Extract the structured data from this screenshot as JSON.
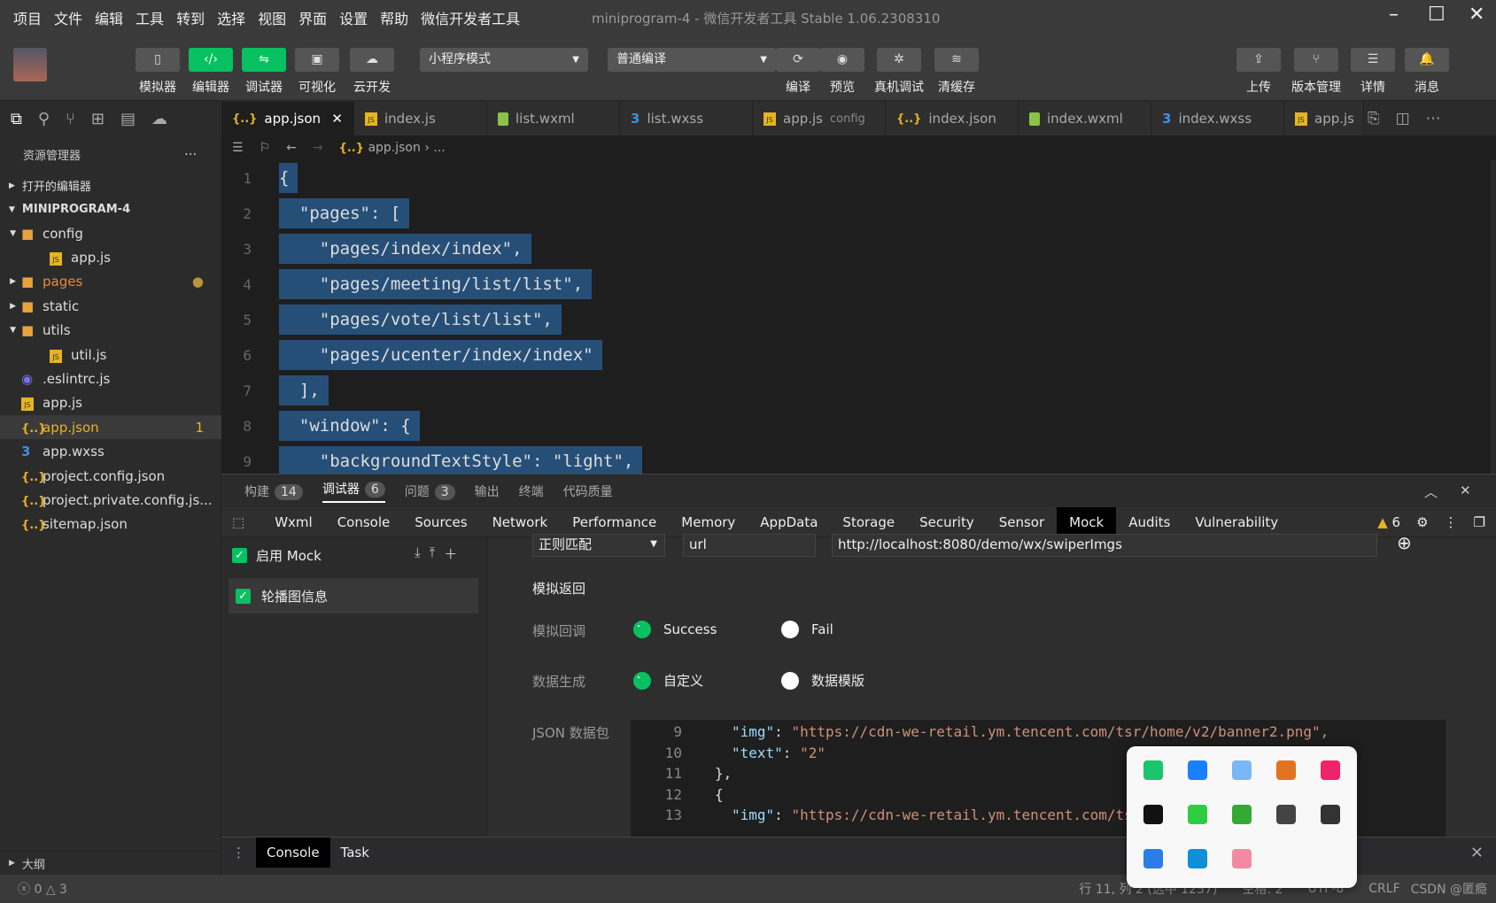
{
  "menu": [
    "项目",
    "文件",
    "编辑",
    "工具",
    "转到",
    "选择",
    "视图",
    "界面",
    "设置",
    "帮助",
    "微信开发者工具"
  ],
  "window_title": "miniprogram-4 - 微信开发者工具 Stable 1.06.2308310",
  "toolbar": {
    "left": [
      {
        "label": "模拟器",
        "icon": "phone-icon",
        "active": false
      },
      {
        "label": "编辑器",
        "icon": "code-icon",
        "active": true
      },
      {
        "label": "调试器",
        "icon": "debug-icon",
        "active": true
      },
      {
        "label": "可视化",
        "icon": "layout-icon",
        "active": false
      },
      {
        "label": "云开发",
        "icon": "cloud-icon",
        "active": false
      }
    ],
    "mode_select": "小程序模式",
    "compile_select": "普通编译",
    "mid": [
      {
        "label": "编译",
        "icon": "refresh-icon"
      },
      {
        "label": "预览",
        "icon": "eye-icon"
      },
      {
        "label": "真机调试",
        "icon": "bug-icon"
      },
      {
        "label": "清缓存",
        "icon": "layers-icon"
      }
    ],
    "right": [
      {
        "label": "上传",
        "icon": "upload-icon"
      },
      {
        "label": "版本管理",
        "icon": "branch-icon"
      },
      {
        "label": "详情",
        "icon": "menu-icon"
      },
      {
        "label": "消息",
        "icon": "bell-icon"
      }
    ]
  },
  "editor_tabs": [
    {
      "label": "app.json",
      "type": "json",
      "active": true
    },
    {
      "label": "index.js",
      "type": "js"
    },
    {
      "label": "list.wxml",
      "type": "wxml"
    },
    {
      "label": "list.wxss",
      "type": "wxss"
    },
    {
      "label": "app.js",
      "suffix": "config",
      "type": "js"
    },
    {
      "label": "index.json",
      "type": "json"
    },
    {
      "label": "index.wxml",
      "type": "wxml"
    },
    {
      "label": "index.wxss",
      "type": "wxss"
    },
    {
      "label": "app.js",
      "type": "js"
    }
  ],
  "sidebar": {
    "title": "资源管理器",
    "more": "...",
    "sections": [
      "打开的编辑器",
      "MINIPROGRAM-4"
    ],
    "items": [
      {
        "label": "config",
        "type": "folder",
        "depth": 1,
        "open": true
      },
      {
        "label": "app.js",
        "type": "js",
        "depth": 2
      },
      {
        "label": "pages",
        "type": "folder",
        "depth": 1,
        "open": false,
        "modified": true
      },
      {
        "label": "static",
        "type": "folder",
        "depth": 1,
        "open": false
      },
      {
        "label": "utils",
        "type": "folder",
        "depth": 1,
        "open": true
      },
      {
        "label": "util.js",
        "type": "js",
        "depth": 2
      },
      {
        "label": ".eslintrc.js",
        "type": "eslint",
        "depth": 1
      },
      {
        "label": "app.js",
        "type": "js",
        "depth": 1
      },
      {
        "label": "app.json",
        "type": "json",
        "depth": 1,
        "selected": true,
        "badge": "1"
      },
      {
        "label": "app.wxss",
        "type": "wxss",
        "depth": 1
      },
      {
        "label": "project.config.json",
        "type": "json",
        "depth": 1
      },
      {
        "label": "project.private.config.js...",
        "type": "json",
        "depth": 1
      },
      {
        "label": "sitemap.json",
        "type": "json",
        "depth": 1
      }
    ],
    "outline": "大纲"
  },
  "breadcrumb": [
    "app.json",
    "..."
  ],
  "code_lines": [
    {
      "n": "1",
      "t": "{"
    },
    {
      "n": "2",
      "t": "  \"pages\": ["
    },
    {
      "n": "3",
      "t": "    \"pages/index/index\","
    },
    {
      "n": "4",
      "t": "    \"pages/meeting/list/list\","
    },
    {
      "n": "5",
      "t": "    \"pages/vote/list/list\","
    },
    {
      "n": "6",
      "t": "    \"pages/ucenter/index/index\""
    },
    {
      "n": "7",
      "t": "  ],"
    },
    {
      "n": "8",
      "t": "  \"window\": {"
    },
    {
      "n": "9",
      "t": "    \"backgroundTextStyle\": \"light\","
    }
  ],
  "panel_tabs": [
    {
      "label": "构建",
      "badge": "14"
    },
    {
      "label": "调试器",
      "badge": "6",
      "active": true
    },
    {
      "label": "问题",
      "badge": "3"
    },
    {
      "label": "输出"
    },
    {
      "label": "终端"
    },
    {
      "label": "代码质量"
    }
  ],
  "devtools_tabs": [
    "Wxml",
    "Console",
    "Sources",
    "Network",
    "Performance",
    "Memory",
    "AppData",
    "Storage",
    "Security",
    "Sensor",
    "Mock",
    "Audits",
    "Vulnerability"
  ],
  "devtools_active": "Mock",
  "warnings": "6",
  "mock": {
    "enable_label": "启用 Mock",
    "enabled": true,
    "rules": [
      {
        "label": "轮播图信息",
        "checked": true
      }
    ],
    "match_type": "正则匹配",
    "match_field": "url",
    "match_value": "http://localhost:8080/demo/wx/swiperImgs",
    "return_title": "模拟返回",
    "callback_label": "模拟回调",
    "callback_options": [
      "Success",
      "Fail"
    ],
    "callback_selected": "Success",
    "gen_label": "数据生成",
    "gen_options": [
      "自定义",
      "数据模版"
    ],
    "gen_selected": "自定义",
    "json_label": "JSON 数据包",
    "json_lines": [
      {
        "n": "9",
        "k": "\"img\"",
        "v": "\"https://cdn-we-retail.ym.tencent.com/tsr/home/v2/banner2.png\","
      },
      {
        "n": "10",
        "k": "\"text\"",
        "v": "\"2\""
      },
      {
        "n": "11",
        "raw": "},"
      },
      {
        "n": "12",
        "raw": "{"
      },
      {
        "n": "13",
        "k": "\"img\"",
        "v": "\"https://cdn-we-retail.ym.tencent.com/tsr/home/v2/banner3.png\","
      }
    ]
  },
  "drawer_tabs": [
    "Console",
    "Task"
  ],
  "status": {
    "errors": "0",
    "warnings": "3",
    "position": "行 11, 列 2 (选中 1257)",
    "indent": "空格: 2",
    "encoding": "UTF-8",
    "eol": "CRLF",
    "watermark": "CSDN @匿瘾"
  },
  "tray_icons": [
    "iqiyi-icon",
    "feishu-icon",
    "baidu-netdisk-icon",
    "java-icon",
    "kuaishou-icon",
    "bookmark-app-icon",
    "wechat-icon",
    "nvidia-icon",
    "keyboard-icon",
    "usb-icon",
    "defender-icon",
    "edge-icon",
    "bilibili-icon"
  ]
}
